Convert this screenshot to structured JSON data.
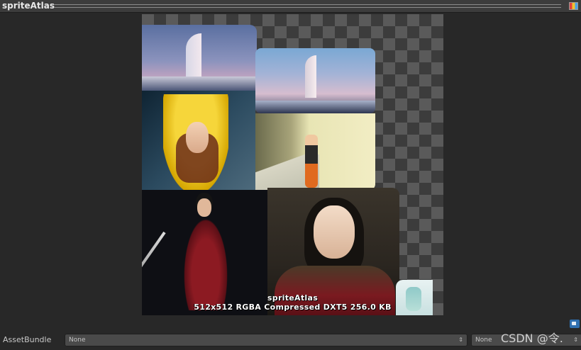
{
  "window": {
    "title": "spriteAtlas"
  },
  "preview": {
    "name": "spriteAtlas",
    "info": "512x512 RGBA Compressed DXT5   256.0 KB"
  },
  "footer": {
    "assetbundle_label": "AssetBundle",
    "assetbundle_name": "None",
    "assetbundle_variant": "None"
  },
  "watermark": "CSDN @令.",
  "colors": {
    "background": "#282828",
    "header": "#3c3c3c",
    "tag_icon": "#2f6fb0"
  },
  "icons": [
    "layers-icon",
    "chevron-updown-icon",
    "tag-icon"
  ]
}
